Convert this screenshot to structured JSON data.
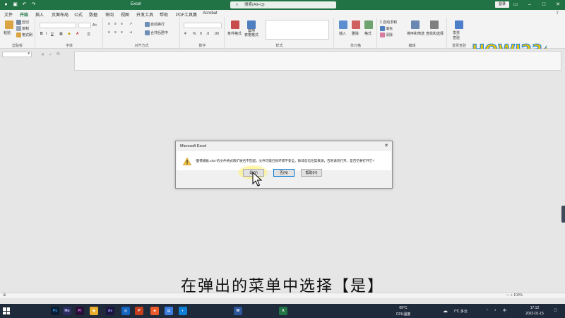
{
  "window": {
    "title": "Excel",
    "search_placeholder": "搜索(Alt+Q)",
    "signin_label": "登录",
    "controls": [
      "–",
      "□",
      "✕"
    ]
  },
  "menu": {
    "tabs": [
      "文件",
      "开始",
      "插入",
      "页面布局",
      "公式",
      "数据",
      "审阅",
      "视图",
      "开发工具",
      "帮助",
      "PDF工具集",
      "Acrobat"
    ],
    "active_tab": "开始"
  },
  "ribbon": {
    "clipboard": {
      "paste": "粘贴",
      "cut": "剪切",
      "copy": "复制",
      "format_painter": "格式刷",
      "label": "剪贴板"
    },
    "font": {
      "label": "字体"
    },
    "alignment": {
      "wrap_text": "自动换行",
      "merge_center": "合并后居中",
      "label": "对齐方式"
    },
    "number": {
      "label": "数字"
    },
    "styles": {
      "conditional_format": "条件格式",
      "format_as_table_1": "套用",
      "format_as_table_2": "表格格式",
      "label": "样式"
    },
    "cells": {
      "insert": "插入",
      "delete": "删除",
      "format": "格式",
      "label": "单元格"
    },
    "editing": {
      "autosum": "自动求和",
      "fill": "填充",
      "clear": "清除",
      "sort_filter": "排序和筛选",
      "find_select": "查找和选择",
      "label": "编辑"
    },
    "invoice": {
      "label_1": "发票",
      "label_2": "查验",
      "group_label": "发票查验"
    }
  },
  "formula_bar": {
    "fx": "fx",
    "cancel": "✕",
    "enter": "✓"
  },
  "dialog": {
    "title": "Microsoft Excel",
    "message": "\"面荷模板.xlsx\"的文件格式和扩展名不匹配。文件可能已损坏或不安全。除非您信任其来源，否则请勿打开。是否仍要打开它?",
    "buttons": {
      "yes": "是(Y)",
      "no": "否(N)",
      "help": "帮助(H)"
    }
  },
  "subtitle": "在弹出的菜单中选择【是】",
  "statusbar": {
    "left": "⊞",
    "right": "— + 100%"
  },
  "taskbar": {
    "apps": [
      {
        "label": "Ps",
        "color": "#0a1e33",
        "fg": "#31a8ff"
      },
      {
        "label": "Mo",
        "color": "#2b2e5f",
        "fg": "#c8c8ff"
      },
      {
        "label": "Pr",
        "color": "#2a0f36",
        "fg": "#ea77ff"
      },
      {
        "label": "◉",
        "color": "#e8b02a",
        "fg": "#ffffff"
      },
      {
        "label": "Ae",
        "color": "#1b1640",
        "fg": "#9999ff"
      },
      {
        "label": "◎",
        "color": "#1565c0",
        "fg": "#ffffff"
      },
      {
        "label": "P",
        "color": "#c43e1c",
        "fg": "#ffffff"
      },
      {
        "label": "◈",
        "color": "#ea5a2a",
        "fg": "#ffffff"
      },
      {
        "label": "▤",
        "color": "#3b7ddd",
        "fg": "#ffffff"
      },
      {
        "label": "◐",
        "color": "#0f7fd6",
        "fg": "#ffffff"
      },
      {
        "label": "W",
        "color": "#2b579a",
        "fg": "#ffffff"
      },
      {
        "label": "X",
        "color": "#217346",
        "fg": "#ffffff"
      }
    ],
    "cpu_temp": "69°C",
    "cpu_label": "CPU温度",
    "weather": "7°C 多云",
    "time": "17:12",
    "date": "2022-01-15"
  },
  "colors": {
    "excel_green": "#217346",
    "dialog_focus": "#0078d7",
    "taskbar_bg": "#1f2a3b"
  },
  "watermark": {
    "text": "HOWJ234"
  }
}
